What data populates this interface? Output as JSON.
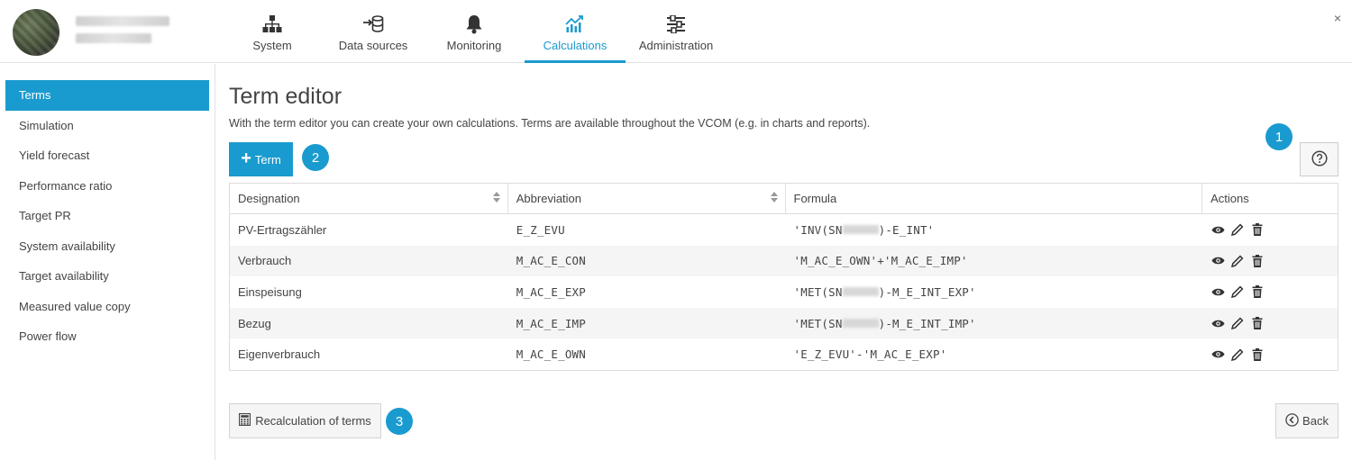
{
  "nav": {
    "items": [
      {
        "label": "System",
        "icon": "sitemap-icon"
      },
      {
        "label": "Data sources",
        "icon": "data-import-icon"
      },
      {
        "label": "Monitoring",
        "icon": "bell-icon"
      },
      {
        "label": "Calculations",
        "icon": "chart-line-icon",
        "active": true
      },
      {
        "label": "Administration",
        "icon": "sliders-icon"
      }
    ],
    "close": "×"
  },
  "sidebar": {
    "items": [
      {
        "label": "Terms",
        "active": true
      },
      {
        "label": "Simulation"
      },
      {
        "label": "Yield forecast"
      },
      {
        "label": "Performance ratio"
      },
      {
        "label": "Target PR"
      },
      {
        "label": "System availability"
      },
      {
        "label": "Target availability"
      },
      {
        "label": "Measured value copy"
      },
      {
        "label": "Power flow"
      }
    ]
  },
  "main": {
    "title": "Term editor",
    "description": "With the term editor you can create your own calculations. Terms are available throughout the VCOM (e.g. in charts and reports).",
    "add_term_label": "Term",
    "badges": [
      "1",
      "2",
      "3"
    ],
    "table": {
      "headers": [
        "Designation",
        "Abbreviation",
        "Formula",
        "Actions"
      ],
      "rows": [
        {
          "designation": "PV-Ertragszähler",
          "abbreviation": "E_Z_EVU",
          "formula_pre": "'INV(SN",
          "formula_post": ")-E_INT'"
        },
        {
          "designation": "Verbrauch",
          "abbreviation": "M_AC_E_CON",
          "formula_pre": "'M_AC_E_OWN'+'M_AC_E_IMP'",
          "formula_post": ""
        },
        {
          "designation": "Einspeisung",
          "abbreviation": "M_AC_E_EXP",
          "formula_pre": "'MET(SN",
          "formula_post": ")-M_E_INT_EXP'"
        },
        {
          "designation": "Bezug",
          "abbreviation": "M_AC_E_IMP",
          "formula_pre": "'MET(SN",
          "formula_post": ")-M_E_INT_IMP'"
        },
        {
          "designation": "Eigenverbrauch",
          "abbreviation": "M_AC_E_OWN",
          "formula_pre": "'E_Z_EVU'-'M_AC_E_EXP'",
          "formula_post": ""
        }
      ]
    },
    "recalc_label": "Recalculation of terms",
    "back_label": "Back"
  },
  "colors": {
    "accent": "#1a9bcf",
    "text": "#444444",
    "row_alt": "#f5f5f5"
  }
}
